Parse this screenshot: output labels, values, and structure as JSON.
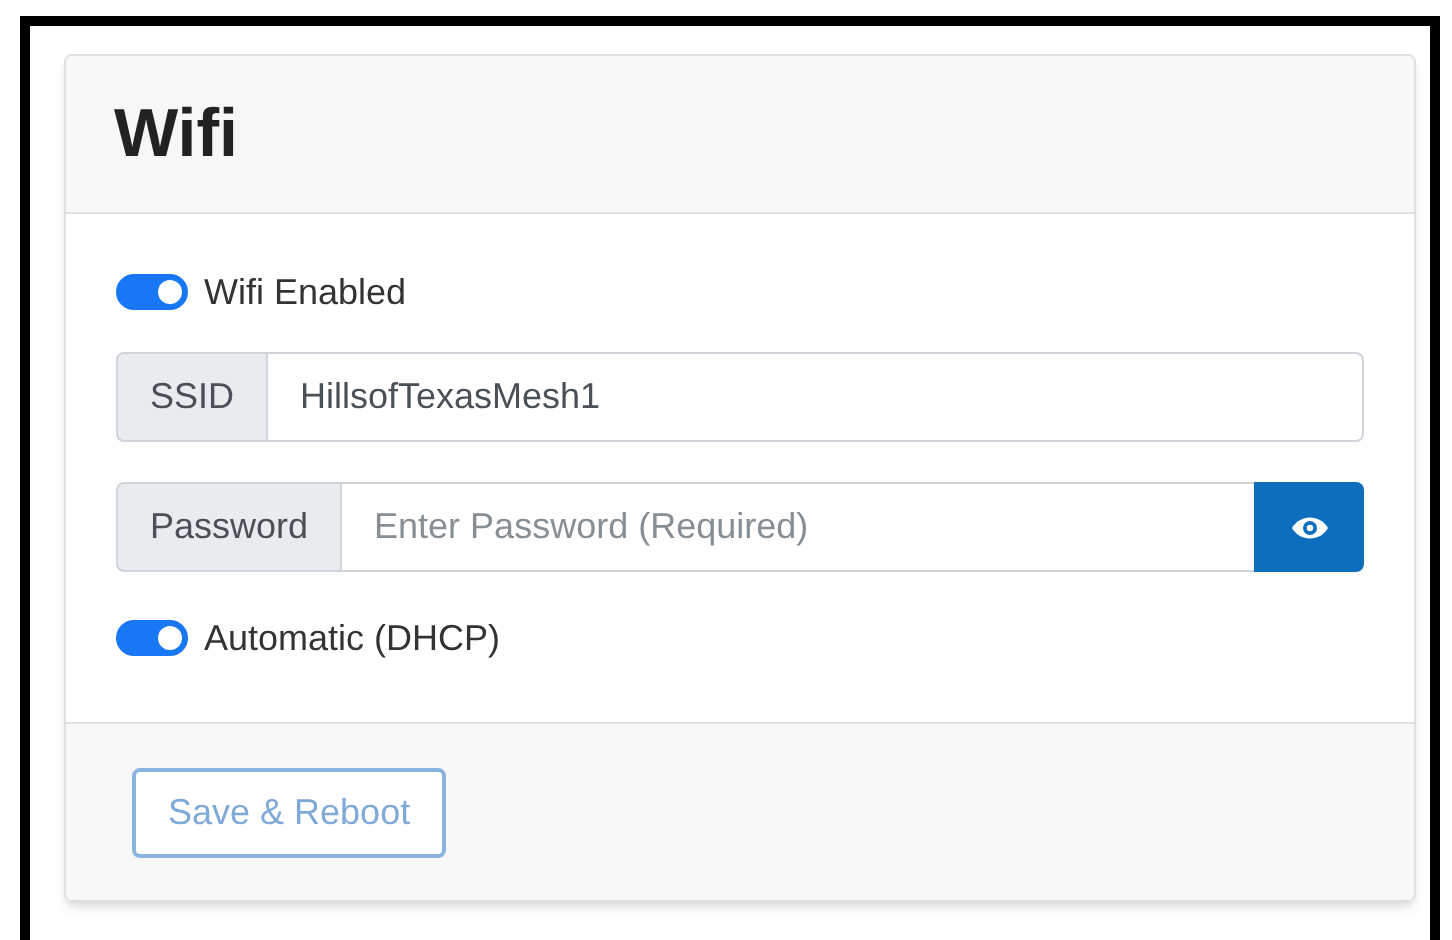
{
  "card": {
    "title": "Wifi"
  },
  "toggles": [
    {
      "label": "Wifi Enabled",
      "on": true
    },
    {
      "label": "Automatic (DHCP)",
      "on": true
    }
  ],
  "fields": [
    {
      "kind": "text",
      "label": "SSID",
      "value": "HillsofTexasMesh1"
    },
    {
      "kind": "password",
      "label": "Password",
      "placeholder": "Enter Password (Required)"
    }
  ],
  "save_button": {
    "label": "Save & Reboot",
    "disabled": true
  }
}
